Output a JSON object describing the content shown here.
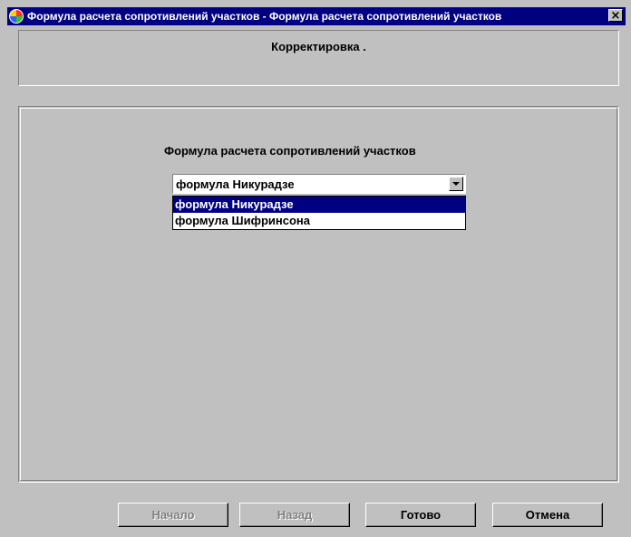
{
  "window": {
    "title": "Формула расчета сопротивлений участков - Формула расчета сопротивлений участков",
    "close_label": "×"
  },
  "header": {
    "title": "Корректировка ."
  },
  "main": {
    "field_label": "Формула расчета сопротивлений участков",
    "combo": {
      "selected": "формула Никурадзе",
      "options": [
        "формула Никурадзе",
        "формула Шифринсона"
      ],
      "highlighted_index": 0
    }
  },
  "buttons": {
    "start": "Начало",
    "back": "Назад",
    "done": "Готово",
    "cancel": "Отмена"
  },
  "colors": {
    "titlebar": "#000080",
    "face": "#c0c0c0",
    "highlight": "#000080"
  }
}
